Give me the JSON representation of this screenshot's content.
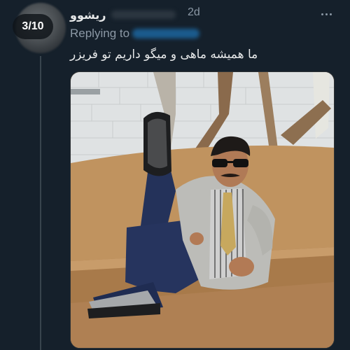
{
  "thread": {
    "counter": "3/10"
  },
  "tweet": {
    "display_name": "ریشوو",
    "time": "2d",
    "replying_label": "Replying to",
    "text": "ما همیشه ماهی و میگو داریم تو فریزر"
  },
  "icons": {
    "more": "more-horizontal-icon"
  },
  "colors": {
    "background": "#15202b",
    "text": "#e7e9ea",
    "secondary": "#8b98a5",
    "thread_line": "#38444d"
  }
}
